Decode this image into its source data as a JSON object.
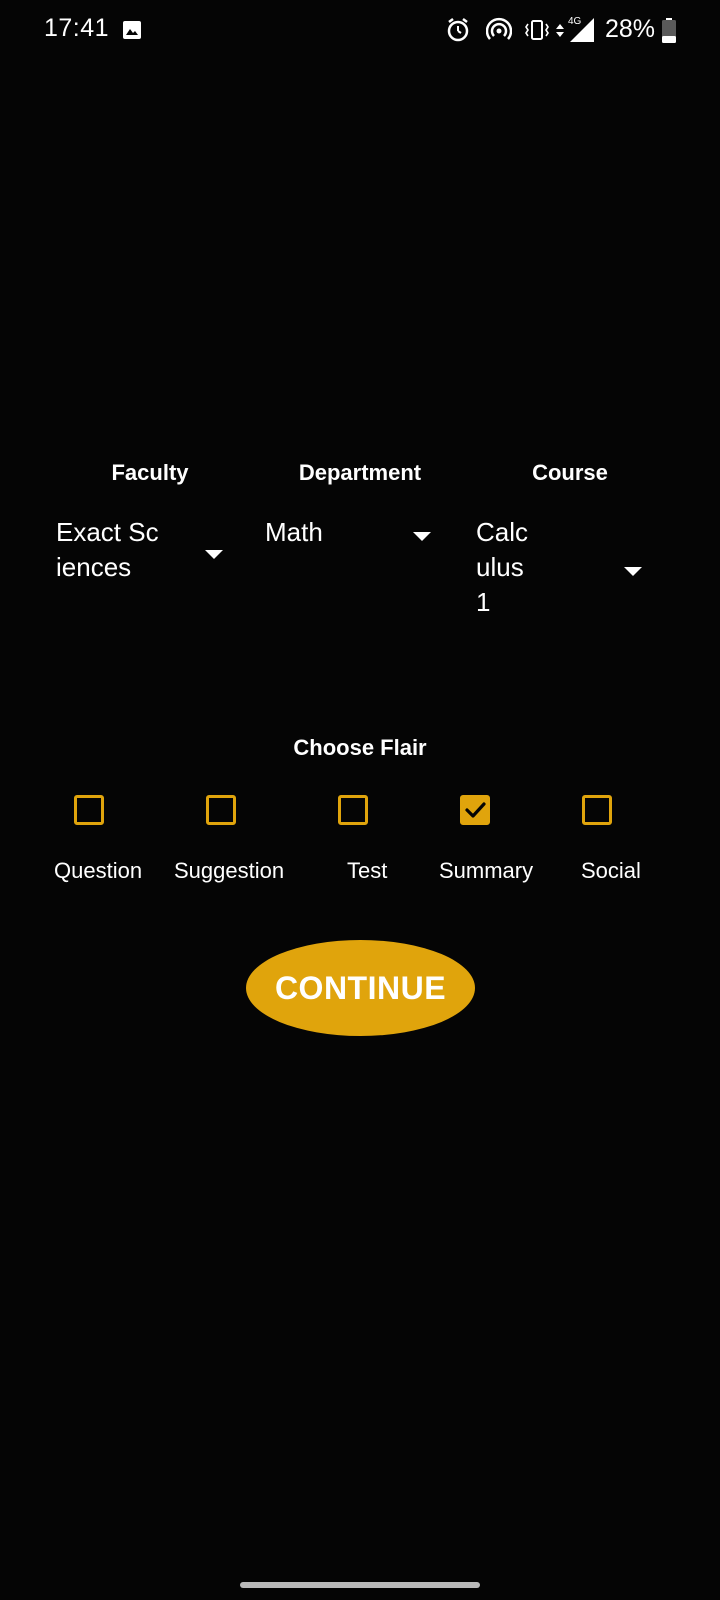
{
  "status_bar": {
    "time": "17:41",
    "network": "4G",
    "battery": "28%",
    "icons": [
      "gallery-icon",
      "alarm-icon",
      "hotspot-icon",
      "vibrate-icon",
      "data-arrows-icon",
      "signal-icon",
      "battery-icon"
    ]
  },
  "selectors": {
    "faculty": {
      "header": "Faculty",
      "value": "Exact Sciences"
    },
    "department": {
      "header": "Department",
      "value": "Math"
    },
    "course": {
      "header": "Course",
      "value": "Calculus 1"
    }
  },
  "flair": {
    "title": "Choose Flair",
    "options": [
      {
        "label": "Question",
        "checked": false
      },
      {
        "label": "Suggestion",
        "checked": false
      },
      {
        "label": "Test",
        "checked": false
      },
      {
        "label": "Summary",
        "checked": true
      },
      {
        "label": "Social",
        "checked": false
      }
    ]
  },
  "continue_button": {
    "label": "CONTINUE"
  },
  "colors": {
    "background": "#050505",
    "accent": "#e0a40c",
    "text": "#ffffff"
  }
}
